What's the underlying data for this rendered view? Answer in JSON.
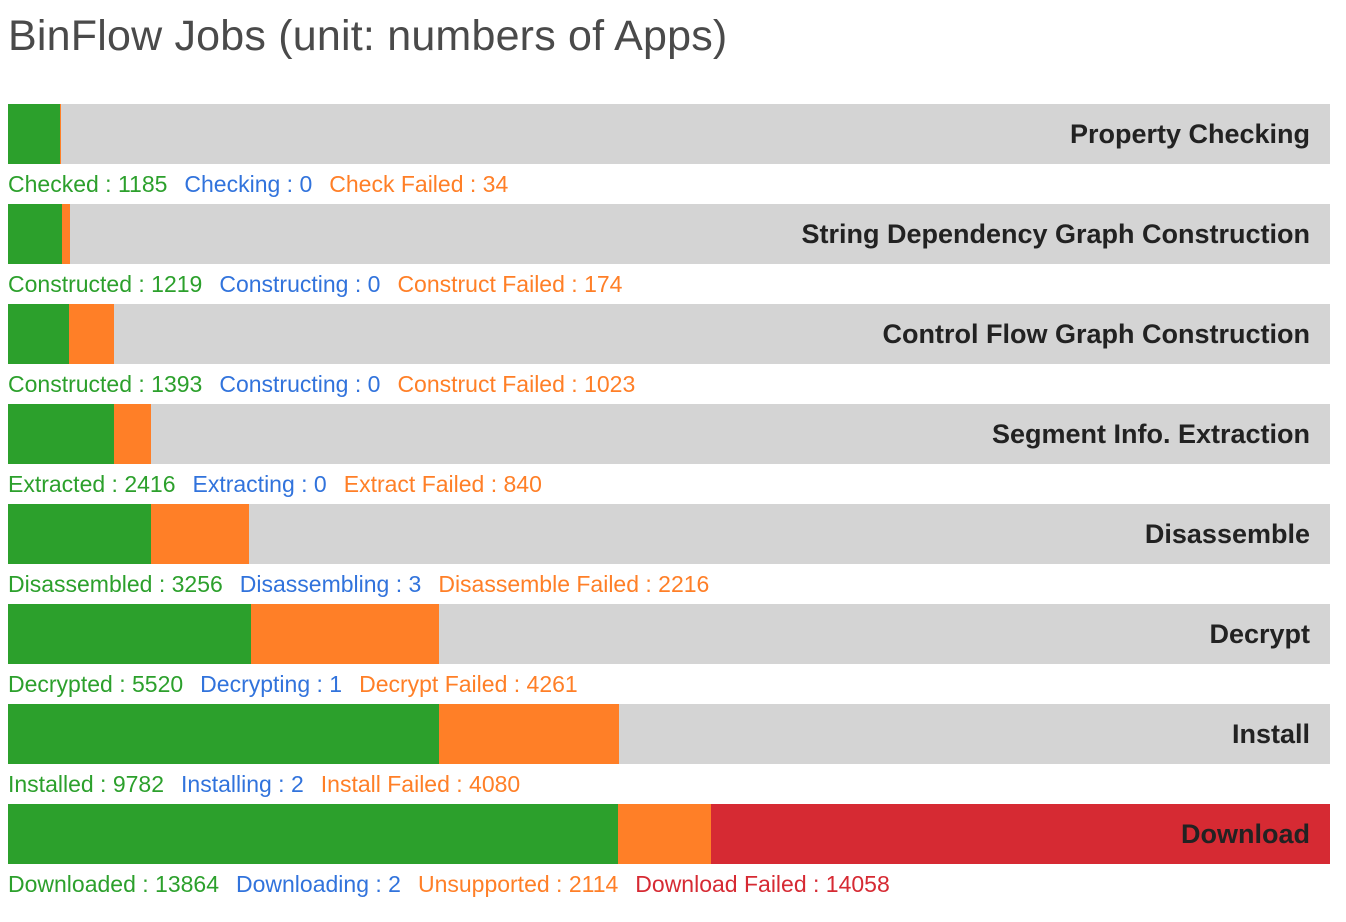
{
  "title": "BinFlow Jobs (unit: numbers of Apps)",
  "colors": {
    "done": "#2ca02c",
    "progress": "#3173dc",
    "unsupported": "#ff7f27",
    "failed": "#d62a33",
    "track": "#d4d4d4"
  },
  "chart_data": {
    "type": "bar",
    "orientation": "horizontal-stacked",
    "total_scale": 30038,
    "stages": [
      {
        "label": "Property Checking",
        "items": [
          {
            "text": "Checked : 1185",
            "value": 1185,
            "color": "done"
          },
          {
            "text": "Checking : 0",
            "value": 0,
            "color": "progress"
          },
          {
            "text": "Check Failed : 34",
            "value": 34,
            "color": "unsupported"
          }
        ]
      },
      {
        "label": "String Dependency Graph Construction",
        "items": [
          {
            "text": "Constructed : 1219",
            "value": 1219,
            "color": "done"
          },
          {
            "text": "Constructing : 0",
            "value": 0,
            "color": "progress"
          },
          {
            "text": "Construct Failed : 174",
            "value": 174,
            "color": "unsupported"
          }
        ]
      },
      {
        "label": "Control Flow Graph Construction",
        "items": [
          {
            "text": "Constructed : 1393",
            "value": 1393,
            "color": "done"
          },
          {
            "text": "Constructing : 0",
            "value": 0,
            "color": "progress"
          },
          {
            "text": "Construct Failed : 1023",
            "value": 1023,
            "color": "unsupported"
          }
        ]
      },
      {
        "label": "Segment Info. Extraction",
        "items": [
          {
            "text": "Extracted : 2416",
            "value": 2416,
            "color": "done"
          },
          {
            "text": "Extracting : 0",
            "value": 0,
            "color": "progress"
          },
          {
            "text": "Extract Failed : 840",
            "value": 840,
            "color": "unsupported"
          }
        ]
      },
      {
        "label": "Disassemble",
        "items": [
          {
            "text": "Disassembled : 3256",
            "value": 3256,
            "color": "done"
          },
          {
            "text": "Disassembling : 3",
            "value": 3,
            "color": "progress"
          },
          {
            "text": "Disassemble Failed : 2216",
            "value": 2216,
            "color": "unsupported"
          }
        ]
      },
      {
        "label": "Decrypt",
        "items": [
          {
            "text": "Decrypted : 5520",
            "value": 5520,
            "color": "done"
          },
          {
            "text": "Decrypting : 1",
            "value": 1,
            "color": "progress"
          },
          {
            "text": "Decrypt Failed : 4261",
            "value": 4261,
            "color": "unsupported"
          }
        ]
      },
      {
        "label": "Install",
        "items": [
          {
            "text": "Installed : 9782",
            "value": 9782,
            "color": "done"
          },
          {
            "text": "Installing : 2",
            "value": 2,
            "color": "progress"
          },
          {
            "text": "Install Failed : 4080",
            "value": 4080,
            "color": "unsupported"
          }
        ]
      },
      {
        "label": "Download",
        "items": [
          {
            "text": "Downloaded : 13864",
            "value": 13864,
            "color": "done"
          },
          {
            "text": "Downloading : 2",
            "value": 2,
            "color": "progress"
          },
          {
            "text": "Unsupported : 2114",
            "value": 2114,
            "color": "unsupported"
          },
          {
            "text": "Download Failed : 14058",
            "value": 14058,
            "color": "failed"
          }
        ]
      }
    ]
  }
}
